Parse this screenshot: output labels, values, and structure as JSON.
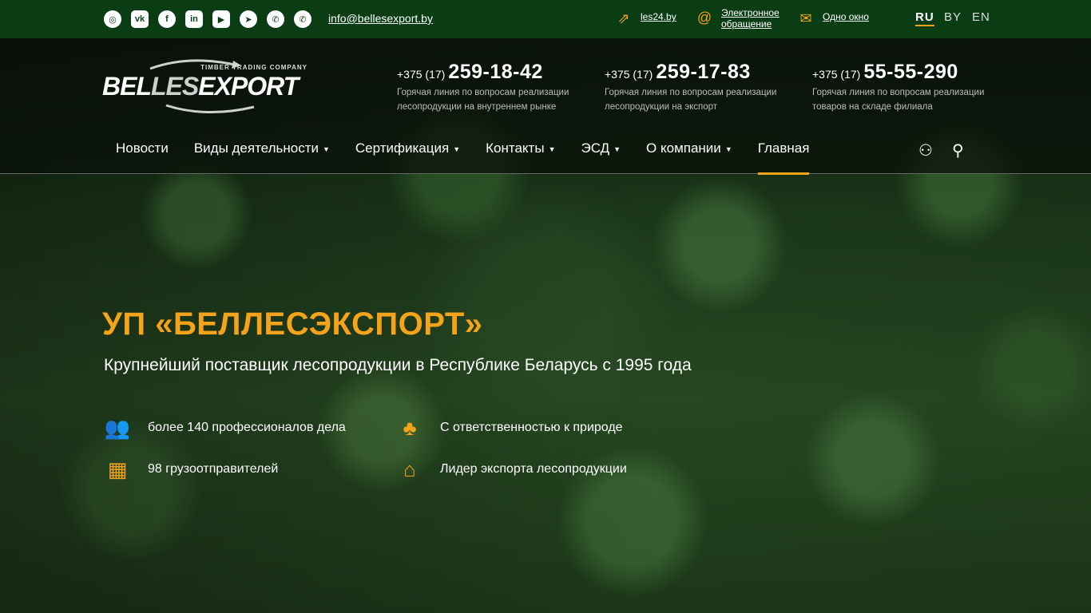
{
  "topbar": {
    "social": [
      {
        "name": "instagram-icon",
        "glyph": "◎"
      },
      {
        "name": "vk-icon",
        "glyph": "vk"
      },
      {
        "name": "facebook-icon",
        "glyph": "f"
      },
      {
        "name": "linkedin-icon",
        "glyph": "in"
      },
      {
        "name": "youtube-icon",
        "glyph": "▶"
      },
      {
        "name": "telegram-icon",
        "glyph": "➤"
      },
      {
        "name": "viber-icon",
        "glyph": "✆"
      },
      {
        "name": "whatsapp-icon",
        "glyph": "✆"
      }
    ],
    "email": "info@bellesexport.by",
    "les24_label": "les24.by",
    "appeal_line1": "Электронное",
    "appeal_line2": "обращение",
    "window_label": "Одно окно",
    "languages": {
      "ru": "RU",
      "by": "BY",
      "en": "EN"
    }
  },
  "logo": {
    "tagline": "TIMBER TRADING COMPANY",
    "part1": "BEL",
    "part2": "LES",
    "part3": "EXPORT"
  },
  "phones": [
    {
      "code": "+375 (17)",
      "number": "259-18-42",
      "desc": "Горячая линия по вопросам реализации лесопродукции на внутреннем рынке"
    },
    {
      "code": "+375 (17)",
      "number": "259-17-83",
      "desc": "Горячая линия по вопросам реализации лесопродукции на экспорт"
    },
    {
      "code": "+375 (17)",
      "number": "55-55-290",
      "desc": "Горячая линия по вопросам реализации товаров на складе филиала"
    }
  ],
  "nav": {
    "news": "Новости",
    "activities": "Виды деятельности",
    "certification": "Сертификация",
    "contacts": "Контакты",
    "esd": "ЭСД",
    "about": "О компании",
    "home": "Главная"
  },
  "hero": {
    "title": "УП «БЕЛЛЕСЭКСПОРТ»",
    "subtitle": "Крупнейший поставщик лесопродукции в Республике Беларусь с 1995 года"
  },
  "features": {
    "professionals": "более 140 профессионалов дела",
    "nature": "С ответственностью к природе",
    "shippers": "98 грузоотправителей",
    "leader": "Лидер экспорта лесопродукции"
  },
  "colors": {
    "accent": "#f5a31a",
    "topbar": "#0a3d14"
  }
}
